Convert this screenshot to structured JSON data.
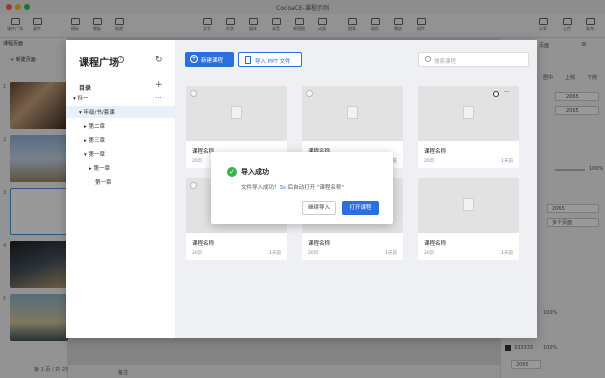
{
  "window": {
    "title": "CocoaCE-课程示例"
  },
  "toolbar": {
    "left": [
      {
        "label": "课件广场",
        "icon": "plaza-icon"
      },
      {
        "label": "意件",
        "icon": "file-icon"
      },
      {
        "label": "模板",
        "icon": "template-icon"
      },
      {
        "label": "模板",
        "icon": "template2-icon"
      },
      {
        "label": "新建",
        "icon": "add-icon"
      }
    ],
    "center": [
      {
        "label": "文字",
        "icon": "text-icon"
      },
      {
        "label": "形状",
        "icon": "shape-icon"
      },
      {
        "label": "媒体",
        "icon": "media-icon"
      },
      {
        "label": "录音",
        "icon": "record-icon"
      },
      {
        "label": "原理图",
        "icon": "diagram-icon"
      },
      {
        "label": "动画",
        "icon": "animation-icon"
      },
      {
        "label": "图表",
        "icon": "chart-icon"
      },
      {
        "label": "图形",
        "icon": "graphic-icon"
      },
      {
        "label": "播放",
        "icon": "play-icon"
      },
      {
        "label": "插件",
        "icon": "plugin-icon"
      }
    ],
    "right": [
      {
        "label": "分享",
        "icon": "share-icon"
      },
      {
        "label": "上传",
        "icon": "upload-icon"
      },
      {
        "label": "发布",
        "icon": "publish-icon"
      }
    ]
  },
  "left_panel": {
    "tab": "课程页面",
    "new_page": "+ 新建页面",
    "slide_numbers": [
      "1",
      "2",
      "3",
      "4",
      "5"
    ],
    "page_count": "第 1 页 / 共 25 页"
  },
  "right_panel": {
    "tab": "页面",
    "align_labels": [
      "居中",
      "上侧",
      "下侧"
    ],
    "values": [
      "2065",
      "2065",
      "100%",
      "2065",
      "多个页面",
      "100%",
      "333333",
      "100%",
      "2065"
    ]
  },
  "bottom_bar": {
    "note": "备注"
  },
  "plaza": {
    "title": "课程广场",
    "directory_label": "目录",
    "tree": [
      {
        "label": "科一",
        "indent": 0
      },
      {
        "label": "年级/书/套课",
        "indent": 1,
        "selected": true
      },
      {
        "label": "第二章",
        "indent": 2
      },
      {
        "label": "第三章",
        "indent": 2
      },
      {
        "label": "第一章",
        "indent": 2
      },
      {
        "label": "第一章",
        "indent": 3
      },
      {
        "label": "第一章",
        "indent": 4
      }
    ],
    "new_button": "新建课程",
    "import_button": "导入 PPT 文件",
    "search_placeholder": "搜索课程",
    "cards": [
      {
        "name": "课程名称",
        "pages": "20页",
        "date": "1天前"
      },
      {
        "name": "课程名称",
        "pages": "20页",
        "date": "1天前"
      },
      {
        "name": "课程名称",
        "pages": "20页",
        "date": "1天前"
      },
      {
        "name": "课程名称",
        "pages": "20页",
        "date": "1天前"
      },
      {
        "name": "课程名称",
        "pages": "20页",
        "date": "1天前"
      },
      {
        "name": "课程名称",
        "pages": "20页",
        "date": "1天前"
      }
    ]
  },
  "dialog": {
    "title": "导入成功",
    "message_prefix": "文件导入成功！",
    "seconds": "3s",
    "message_suffix": " 后自动打开 \"课程名称\"",
    "continue_button": "继续导入",
    "open_button": "打开课程"
  },
  "colors": {
    "accent": "#2b6fdc",
    "success": "#3bb14a",
    "window_bg": "#ececec"
  }
}
